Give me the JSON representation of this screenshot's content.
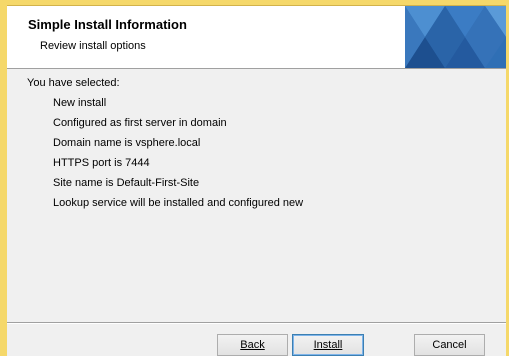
{
  "header": {
    "title": "Simple Install Information",
    "subtitle": "Review install options"
  },
  "summary": {
    "intro": "You have selected:",
    "options": [
      "New install",
      "Configured as first server in domain",
      "Domain name is vsphere.local",
      "HTTPS port is 7444",
      "Site name is Default-First-Site",
      "Lookup service will be installed and configured new"
    ]
  },
  "buttons": {
    "back": "Back",
    "install": "Install",
    "cancel": "Cancel"
  },
  "colors": {
    "banner_dark": "#1d4f8f",
    "banner_mid": "#2f6fb5",
    "banner_light": "#4d8fd1",
    "window_frame": "#f5d86a"
  }
}
